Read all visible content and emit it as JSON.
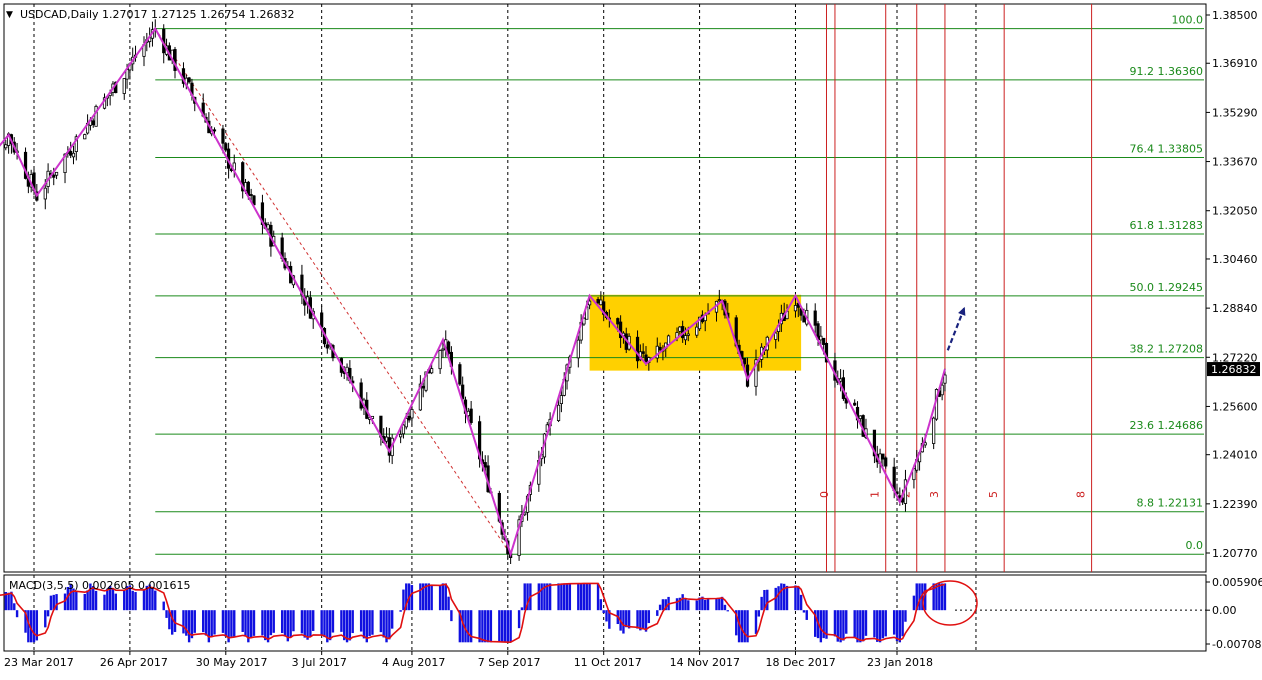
{
  "chart_data": {
    "type": "candlestick",
    "title": "USDCAD,Daily  1.27017 1.27125 1.26754 1.26832",
    "symbol": "USDCAD",
    "timeframe": "Daily",
    "ohlc_last": {
      "open": 1.27017,
      "high": 1.27125,
      "low": 1.26754,
      "close": 1.26832
    },
    "current_price_label": "1.26832",
    "ylim": [
      1.2077,
      1.385
    ],
    "price_ticks": [
      "1.38500",
      "1.36910",
      "1.35290",
      "1.33670",
      "1.32050",
      "1.30460",
      "1.28840",
      "1.27220",
      "1.25600",
      "1.24010",
      "1.22390",
      "1.20770"
    ],
    "date_ticks": [
      "23 Mar 2017",
      "26 Apr 2017",
      "30 May 2017",
      "3 Jul 2017",
      "4 Aug 2017",
      "7 Sep 2017",
      "11 Oct 2017",
      "14 Nov 2017",
      "18 Dec 2017",
      "23 Jan 2018"
    ],
    "fibonacci_levels": [
      {
        "label": "100.0",
        "price": 1.3805
      },
      {
        "label": "91.2  1.36360",
        "price": 1.3636
      },
      {
        "label": "76.4  1.33805",
        "price": 1.33805
      },
      {
        "label": "61.8  1.31283",
        "price": 1.31283
      },
      {
        "label": "50.0  1.29245",
        "price": 1.29245
      },
      {
        "label": "38.2  1.27208",
        "price": 1.27208
      },
      {
        "label": "23.6  1.24686",
        "price": 1.24686
      },
      {
        "label": "8.8  1.22131",
        "price": 1.22131
      },
      {
        "label": "0.0",
        "price": 1.2073
      }
    ],
    "fibonacci_time_labels": [
      "0",
      "1",
      "2",
      "3",
      "5",
      "8"
    ],
    "zigzag": [
      {
        "date": "2017-03-01",
        "price": 1.331
      },
      {
        "date": "2017-03-14",
        "price": 1.3455
      },
      {
        "date": "2017-03-24",
        "price": 1.3255
      },
      {
        "date": "2017-05-05",
        "price": 1.3805
      },
      {
        "date": "2017-07-27",
        "price": 1.2412
      },
      {
        "date": "2017-08-15",
        "price": 1.278
      },
      {
        "date": "2017-09-08",
        "price": 1.2073
      },
      {
        "date": "2017-10-06",
        "price": 1.2925
      },
      {
        "date": "2017-10-26",
        "price": 1.27
      },
      {
        "date": "2017-11-22",
        "price": 1.2908
      },
      {
        "date": "2017-12-01",
        "price": 1.265
      },
      {
        "date": "2017-12-18",
        "price": 1.2925
      },
      {
        "date": "2018-01-24",
        "price": 1.2245
      },
      {
        "date": "2018-02-02",
        "price": 1.2455
      },
      {
        "date": "2018-02-09",
        "price": 1.2683
      }
    ],
    "consolidation_box": {
      "from": "2017-10-06",
      "to": "2017-12-20",
      "top": 1.2928,
      "bottom": 1.2678
    },
    "indicator": {
      "name": "MACD(3,5,5)",
      "label": "MACD(3,5,5)  0.002605 0.001615",
      "macd": 0.002605,
      "signal": 0.001615,
      "ticks": [
        "0.005906",
        "0.00",
        "-0.007086"
      ],
      "ylim": [
        -0.007086,
        0.005906
      ]
    },
    "colors": {
      "bull_candle": "#000000",
      "bear_candle": "#000000",
      "zigzag": "#cc33cc",
      "fib": "#1a8a1a",
      "fib_time": "#cc2020",
      "box": "#ffd000",
      "macd_hist": "#1010e0",
      "signal": "#e01010",
      "arrow": "#1a237e"
    }
  }
}
